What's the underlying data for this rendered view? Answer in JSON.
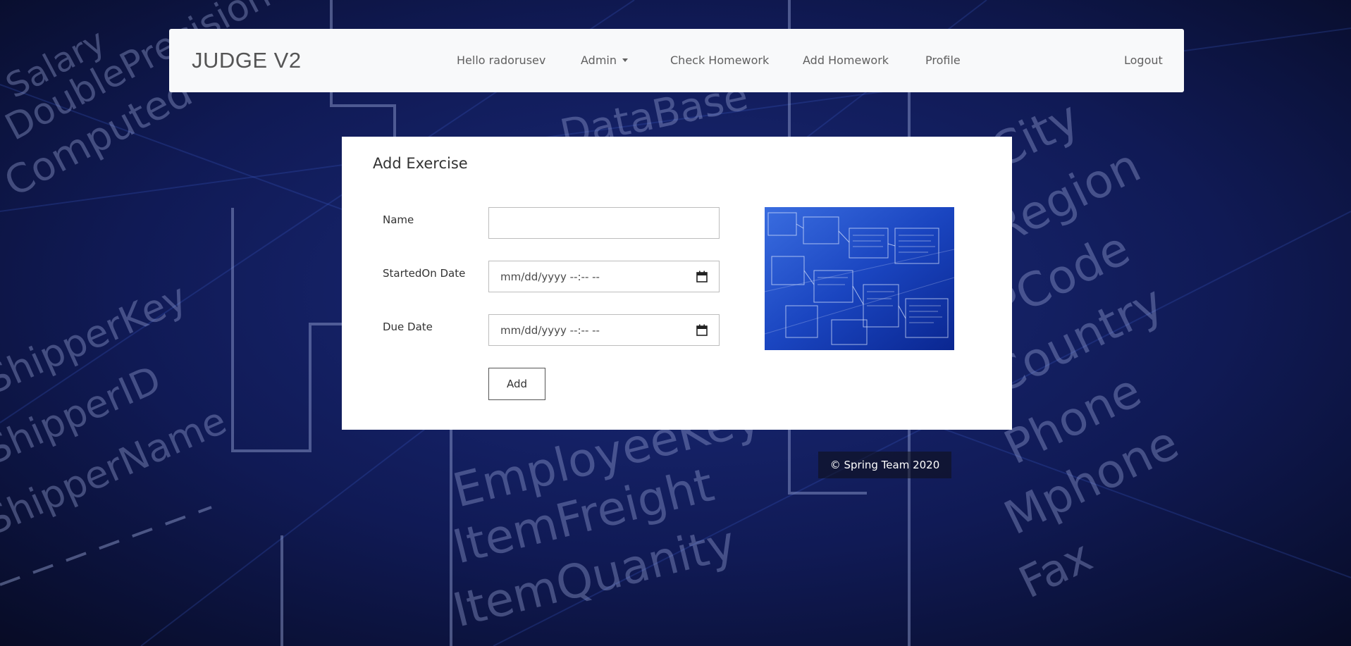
{
  "navbar": {
    "brand": "JUDGE V2",
    "greeting": "Hello radorusev",
    "admin": "Admin",
    "check_homework": "Check Homework",
    "add_homework": "Add Homework",
    "profile": "Profile",
    "logout": "Logout"
  },
  "form": {
    "title": "Add Exercise",
    "name_label": "Name",
    "name_value": "",
    "started_label": "StartedOn Date",
    "started_placeholder": "mm/dd/yyyy --:-- --",
    "due_label": "Due Date",
    "due_placeholder": "mm/dd/yyyy --:-- --",
    "submit_label": "Add"
  },
  "footer": {
    "text": "© Spring Team 2020"
  },
  "icons": {
    "calendar": "calendar-icon",
    "dropdown": "chevron-down-icon"
  },
  "colors": {
    "background_dark": "#0a0f2e",
    "background_blue": "#1e3a9e",
    "navbar_bg": "#f8f9fa",
    "card_bg": "#ffffff",
    "text_dark": "#333333",
    "nav_text": "#606060"
  }
}
